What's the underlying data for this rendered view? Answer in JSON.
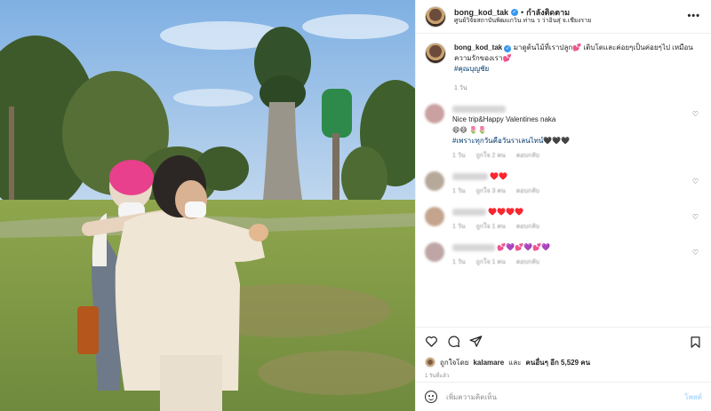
{
  "colors": {
    "accent": "#3897f0",
    "link": "#00376b",
    "muted": "#8e8e8e",
    "post_disabled": "#b3dbff"
  },
  "header": {
    "username": "bong_kod_tak",
    "separator": "•",
    "follow_label": "กำลังติดตาม",
    "location": "ศูนย์วิจัยสถาบันพิฒแกวิน ท่าน ว ว่าอินสุ่ จ.เชียงราย"
  },
  "caption": {
    "username": "bong_kod_tak",
    "text": "มาดูต้นไม้ที่เราปลูก💕 เติบโตและค่อยๆเป็นค่อยๆไป เหมือนความรักของเรา💕",
    "hashtag": "#คุณบุญชัย",
    "time": "1 วัน"
  },
  "comments": [
    {
      "text": "Nice trip&Happy Valentines naka",
      "text2": "😄😄 🌷🌷",
      "tag": "#เพราะทุกวันคือวันราเลนไทน์🖤🖤🖤",
      "time": "1 วัน",
      "likes": "ถูกใจ 2 คน",
      "reply": "ตอบกลับ",
      "avatar_color": "#caa0a0"
    },
    {
      "text": "♥️♥️",
      "time": "1 วัน",
      "likes": "ถูกใจ 3 คน",
      "reply": "ตอบกลับ",
      "avatar_color": "#b7a99a"
    },
    {
      "text": "♥️♥️♥️♥️",
      "time": "1 วัน",
      "likes": "ถูกใจ 1 คน",
      "reply": "ตอบกลับ",
      "avatar_color": "#c5a48d"
    },
    {
      "text": "💕💜💕💜💕💜",
      "time": "1 วัน",
      "likes": "ถูกใจ 1 คน",
      "reply": "ตอบกลับ",
      "avatar_color": "#bfa5a5"
    }
  ],
  "actions": {
    "like_icon": "heart-outline-icon",
    "comment_icon": "comment-icon",
    "share_icon": "send-icon",
    "save_icon": "bookmark-icon"
  },
  "likes": {
    "prefix": "ถูกใจโดย",
    "user": "kalamare",
    "middle": "และ",
    "others": "คนอื่นๆ อีก 5,529 คน"
  },
  "timeago": "1 วันที่แล้ว",
  "add_comment": {
    "placeholder": "เพิ่มความคิดเห็น",
    "post_label": "โพสต์"
  }
}
